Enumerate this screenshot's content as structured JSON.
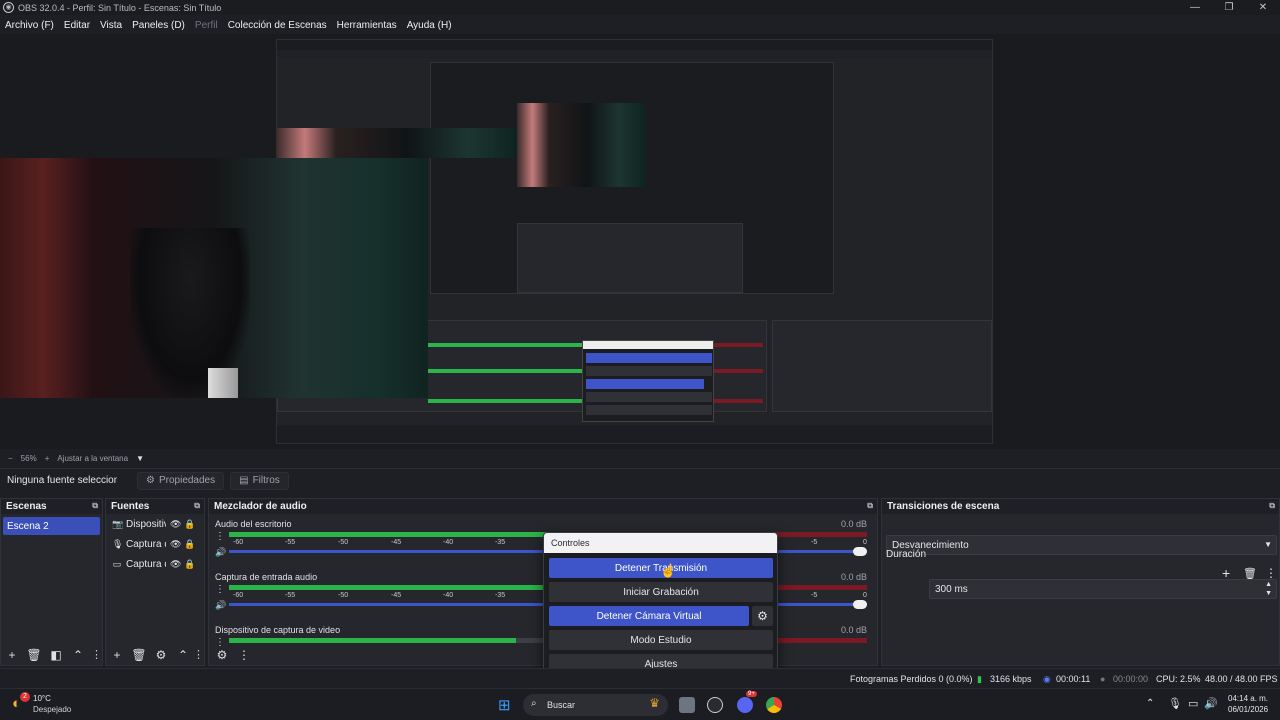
{
  "window": {
    "title": "OBS 32.0.4 - Perfil: Sin Título - Escenas: Sin Título",
    "minimize_icon": "minimize-icon",
    "maximize_icon": "maximize-icon",
    "close_icon": "close-icon"
  },
  "menu": {
    "items": [
      "Archivo (F)",
      "Editar",
      "Vista",
      "Paneles (D)",
      "Perfil",
      "Colección de Escenas",
      "Herramientas",
      "Ayuda (H)"
    ]
  },
  "zoom": {
    "minus": "−",
    "level": "56%",
    "plus": "+",
    "fit_label": "Ajustar a la ventana"
  },
  "context_bar": {
    "no_source": "Ninguna fuente seleccionada",
    "properties": "Propiedades",
    "filters": "Filtros"
  },
  "scenes": {
    "title": "Escenas",
    "items": [
      "Escena 2"
    ]
  },
  "sources": {
    "title": "Fuentes",
    "items": [
      {
        "name": "Dispositivo de captura de video",
        "icon": "camera-icon"
      },
      {
        "name": "Captura de entrada audio",
        "icon": "microphone-icon"
      },
      {
        "name": "Captura de pantalla",
        "icon": "monitor-icon"
      }
    ]
  },
  "mixer": {
    "title": "Mezclador de audio",
    "channels": [
      {
        "name": "Audio del escritorio",
        "db": "0.0 dB",
        "level": 0.6
      },
      {
        "name": "Captura de entrada audio",
        "db": "0.0 dB",
        "level": 0.5
      },
      {
        "name": "Dispositivo de captura de video",
        "db": "0.0 dB",
        "level": 0.45
      }
    ],
    "ticks": [
      "-60",
      "-55",
      "-50",
      "-45",
      "-40",
      "-35",
      "-5",
      "0"
    ]
  },
  "controls": {
    "title": "Controles",
    "stop_stream": "Detener Transmisión",
    "start_recording": "Iniciar Grabación",
    "stop_virtual_cam": "Detener Cámara Virtual",
    "studio_mode": "Modo Estudio",
    "settings": "Ajustes"
  },
  "transitions": {
    "title": "Transiciones de escena",
    "selected": "Desvanecimiento",
    "duration_label": "Duración",
    "duration_value": "300 ms"
  },
  "status": {
    "dropped_frames": "Fotogramas Perdidos 0 (0.0%)",
    "bitrate": "3166 kbps",
    "stream_time": "00:00:11",
    "rec_time": "00:00:00",
    "cpu": "CPU: 2.5%",
    "fps": "48.00 / 48.00 FPS"
  },
  "taskbar": {
    "weather_temp": "10°C",
    "weather_desc": "Despejado",
    "weather_badge": "2",
    "search_placeholder": "Buscar",
    "time": "04:14 a. m.",
    "date": "06/01/2026",
    "discord_badge": "9+"
  },
  "colors": {
    "accent": "#3d55c9",
    "meter_green": "#2bb44a",
    "meter_red": "#7a1a25",
    "background": "#1e1f24"
  }
}
